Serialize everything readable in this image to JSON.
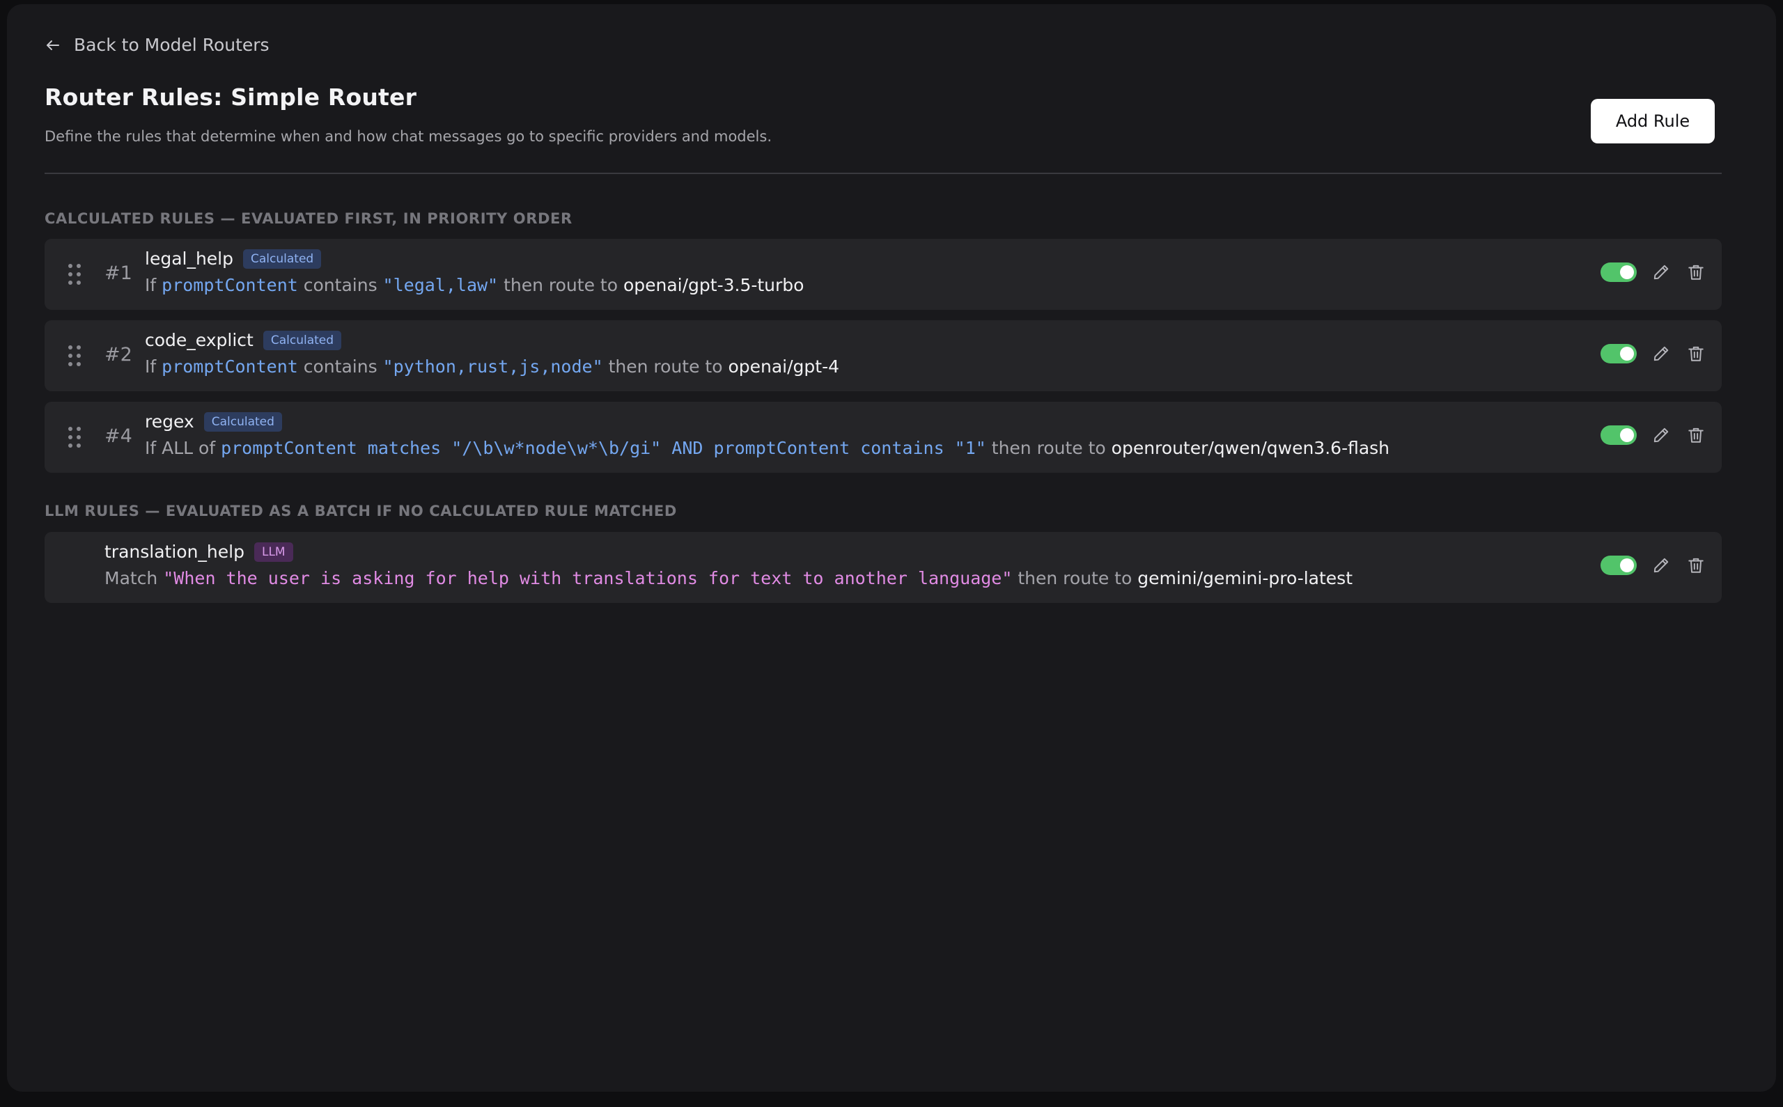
{
  "nav": {
    "back_label": "Back to Model Routers"
  },
  "header": {
    "title": "Router Rules: Simple Router",
    "subtitle": "Define the rules that determine when and how chat messages go to specific providers and models.",
    "add_rule_label": "Add Rule"
  },
  "sections": {
    "calculated_heading": "CALCULATED RULES — EVALUATED FIRST, IN PRIORITY ORDER",
    "llm_heading": "LLM RULES — EVALUATED AS A BATCH IF NO CALCULATED RULE MATCHED"
  },
  "calculated_rules": [
    {
      "num": "#1",
      "name": "legal_help",
      "badge": "Calculated",
      "enabled": true,
      "desc": {
        "if_word": "If",
        "field": "promptContent",
        "op": "contains",
        "value": "\"legal,law\"",
        "then": "then route to",
        "target": "openai/gpt-3.5-turbo"
      }
    },
    {
      "num": "#2",
      "name": "code_explict",
      "badge": "Calculated",
      "enabled": true,
      "desc": {
        "if_word": "If",
        "field": "promptContent",
        "op": "contains",
        "value": "\"python,rust,js,node\"",
        "then": "then route to",
        "target": "openai/gpt-4"
      }
    },
    {
      "num": "#4",
      "name": "regex",
      "badge": "Calculated",
      "enabled": true,
      "desc": {
        "if_word": "If ALL of",
        "expression": "promptContent matches \"/\\b\\w*node\\w*\\b/gi\" AND promptContent contains \"1\"",
        "then": "then route to",
        "target": "openrouter/qwen/qwen3.6-flash"
      }
    }
  ],
  "llm_rules": [
    {
      "name": "translation_help",
      "badge": "LLM",
      "enabled": true,
      "desc": {
        "match_word": "Match",
        "value": "\"When the user is asking for help with translations for text to another language\"",
        "then": "then route to",
        "target": "gemini/gemini-pro-latest"
      }
    }
  ],
  "icons": {
    "back": "arrow-left-icon",
    "drag": "drag-handle-icon",
    "edit": "pencil-icon",
    "delete": "trash-icon"
  },
  "colors": {
    "toggle_on": "#52c46a",
    "badge_calculated_bg": "#2d3c5e",
    "badge_calculated_text": "#8fb2f2",
    "badge_llm_bg": "#4a2a57",
    "badge_llm_text": "#d99bea",
    "code_blue": "#74a7f0",
    "code_pink": "#e18be4"
  }
}
